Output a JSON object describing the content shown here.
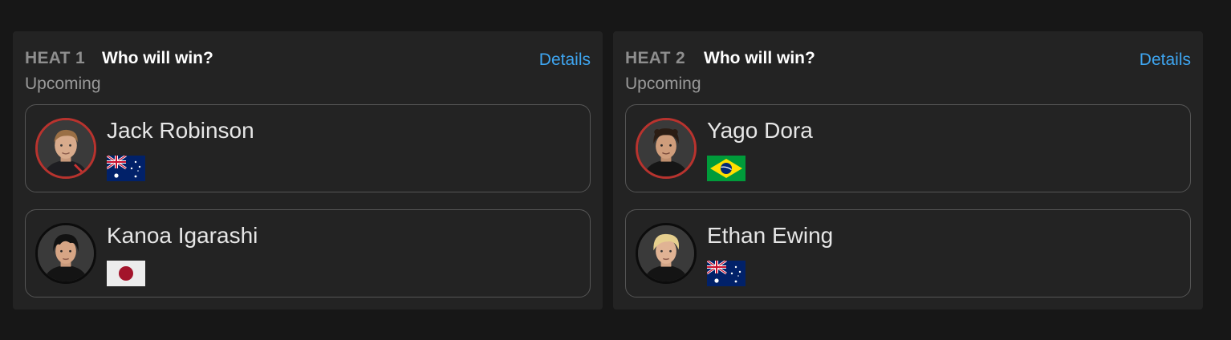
{
  "heats": [
    {
      "label": "HEAT 1",
      "question": "Who will win?",
      "status": "Upcoming",
      "details_label": "Details",
      "surfers": [
        {
          "name": "Jack Robinson",
          "flag": "australia-flag",
          "selected": true,
          "hair": "light-brown"
        },
        {
          "name": "Kanoa Igarashi",
          "flag": "japan-flag",
          "selected": false,
          "hair": "black"
        }
      ]
    },
    {
      "label": "HEAT 2",
      "question": "Who will win?",
      "status": "Upcoming",
      "details_label": "Details",
      "surfers": [
        {
          "name": "Yago Dora",
          "flag": "brazil-flag",
          "selected": true,
          "hair": "dark-brown"
        },
        {
          "name": "Ethan Ewing",
          "flag": "australia-flag",
          "selected": false,
          "hair": "blonde"
        }
      ]
    }
  ],
  "colors": {
    "background": "#171717",
    "card": "#232323",
    "accent_link": "#3ea5f0",
    "selected_ring": "#b8332e"
  }
}
